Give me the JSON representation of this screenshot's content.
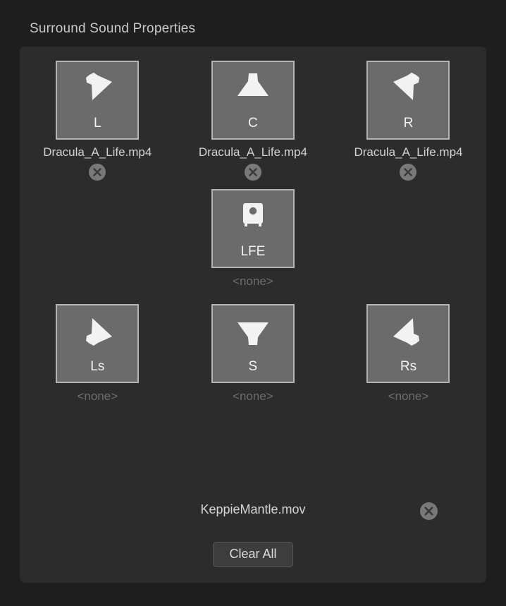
{
  "panel": {
    "title": "Surround Sound Properties"
  },
  "speakers": [
    {
      "id": "L",
      "label": "L",
      "icon": "speaker-cone-down-right-icon",
      "assignment": "Dracula_A_Life.mp4",
      "assigned": true,
      "clear_icon": "close-circle-icon"
    },
    {
      "id": "C",
      "label": "C",
      "icon": "speaker-cone-down-icon",
      "assignment": "Dracula_A_Life.mp4",
      "assigned": true,
      "clear_icon": "close-circle-icon"
    },
    {
      "id": "R",
      "label": "R",
      "icon": "speaker-cone-down-left-icon",
      "assignment": "Dracula_A_Life.mp4",
      "assigned": true,
      "clear_icon": "close-circle-icon"
    },
    {
      "id": "LFE",
      "label": "LFE",
      "icon": "subwoofer-icon",
      "assignment": "<none>",
      "assigned": false,
      "clear_icon": "close-circle-icon"
    },
    {
      "id": "Ls",
      "label": "Ls",
      "icon": "speaker-cone-up-right-icon",
      "assignment": "<none>",
      "assigned": false,
      "clear_icon": "close-circle-icon"
    },
    {
      "id": "S",
      "label": "S",
      "icon": "speaker-cone-up-icon",
      "assignment": "<none>",
      "assigned": false,
      "clear_icon": "close-circle-icon"
    },
    {
      "id": "Rs",
      "label": "Rs",
      "icon": "speaker-cone-up-left-icon",
      "assignment": "<none>",
      "assigned": false,
      "clear_icon": "close-circle-icon"
    }
  ],
  "movie": {
    "name": "KeppieMantle.mov",
    "clear_icon": "close-circle-icon"
  },
  "actions": {
    "clear_all_label": "Clear All"
  },
  "colors": {
    "window_background": "#1e1e1e",
    "panel_background": "#2c2c2c",
    "tile_fill": "#6b6b6b",
    "tile_border": "#b4b4b4",
    "icon_fill": "#f2f2f2",
    "text_primary": "#d2d2d2",
    "text_muted": "#6d6d6d",
    "close_button": "#797979",
    "button_fill": "#3d3d3d"
  }
}
